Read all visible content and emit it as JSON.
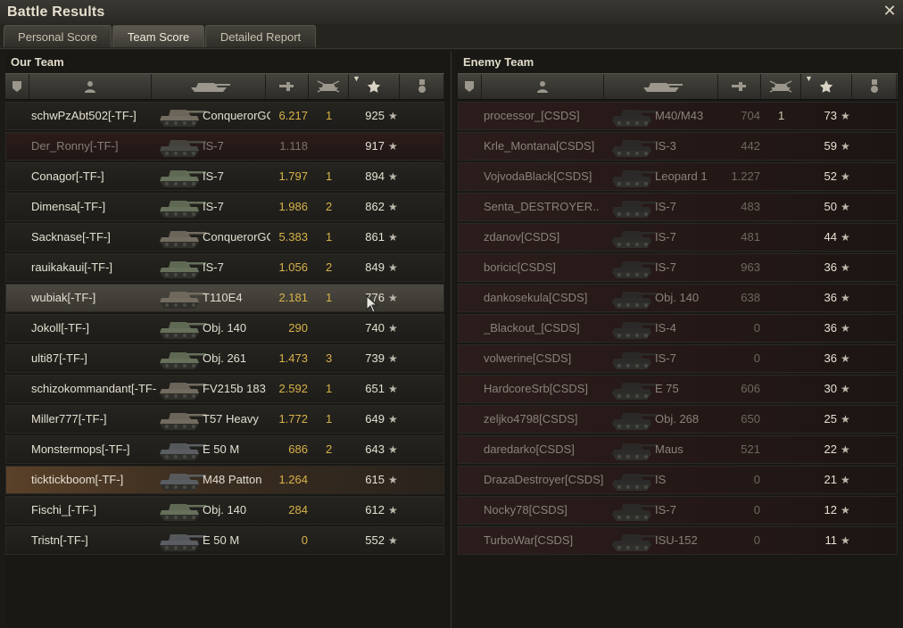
{
  "window": {
    "title": "Battle Results",
    "close_icon": "close-icon"
  },
  "tabs": [
    {
      "label": "Personal Score",
      "active": false
    },
    {
      "label": "Team Score",
      "active": true
    },
    {
      "label": "Detailed Report",
      "active": false
    }
  ],
  "our_team": {
    "title": "Our Team",
    "rows": [
      {
        "player": "schwPzAbt502[-TF-]",
        "tank": "ConquerorGC",
        "damage": "6.217",
        "kills": "1",
        "xp": "925",
        "state": "alive"
      },
      {
        "player": "Der_Ronny[-TF-]",
        "tank": "IS-7",
        "damage": "1.118",
        "kills": "",
        "xp": "917",
        "state": "dead"
      },
      {
        "player": "Conagor[-TF-]",
        "tank": "IS-7",
        "damage": "1.797",
        "kills": "1",
        "xp": "894",
        "state": "alive"
      },
      {
        "player": "Dimensa[-TF-]",
        "tank": "IS-7",
        "damage": "1.986",
        "kills": "2",
        "xp": "862",
        "state": "alive"
      },
      {
        "player": "Sacknase[-TF-]",
        "tank": "ConquerorGC",
        "damage": "5.383",
        "kills": "1",
        "xp": "861",
        "state": "alive"
      },
      {
        "player": "rauikakaui[-TF-]",
        "tank": "IS-7",
        "damage": "1.056",
        "kills": "2",
        "xp": "849",
        "state": "alive"
      },
      {
        "player": "wubiak[-TF-]",
        "tank": "T110E4",
        "damage": "2.181",
        "kills": "1",
        "xp": "776",
        "state": "hover"
      },
      {
        "player": "Jokoll[-TF-]",
        "tank": "Obj. 140",
        "damage": "290",
        "kills": "",
        "xp": "740",
        "state": "alive"
      },
      {
        "player": "ulti87[-TF-]",
        "tank": "Obj. 261",
        "damage": "1.473",
        "kills": "3",
        "xp": "739",
        "state": "alive"
      },
      {
        "player": "schizokommandant[-TF-]",
        "tank": "FV215b 183",
        "damage": "2.592",
        "kills": "1",
        "xp": "651",
        "state": "alive"
      },
      {
        "player": "Miller777[-TF-]",
        "tank": "T57 Heavy",
        "damage": "1.772",
        "kills": "1",
        "xp": "649",
        "state": "alive"
      },
      {
        "player": "Monstermops[-TF-]",
        "tank": "E 50 M",
        "damage": "686",
        "kills": "2",
        "xp": "643",
        "state": "alive"
      },
      {
        "player": "ticktickboom[-TF-]",
        "tank": "M48 Patton",
        "damage": "1.264",
        "kills": "",
        "xp": "615",
        "state": "self"
      },
      {
        "player": "Fischi_[-TF-]",
        "tank": "Obj. 140",
        "damage": "284",
        "kills": "",
        "xp": "612",
        "state": "alive"
      },
      {
        "player": "Tristn[-TF-]",
        "tank": "E 50 M",
        "damage": "0",
        "kills": "",
        "xp": "552",
        "state": "alive"
      }
    ]
  },
  "enemy_team": {
    "title": "Enemy Team",
    "rows": [
      {
        "player": "processor_[CSDS]",
        "tank": "M40/M43",
        "damage": "704",
        "kills": "1",
        "xp": "73",
        "state": "dead"
      },
      {
        "player": "Krle_Montana[CSDS]",
        "tank": "IS-3",
        "damage": "442",
        "kills": "",
        "xp": "59",
        "state": "dead"
      },
      {
        "player": "VojvodaBlack[CSDS]",
        "tank": "Leopard 1",
        "damage": "1.227",
        "kills": "",
        "xp": "52",
        "state": "dead"
      },
      {
        "player": "Senta_DESTROYER..",
        "tank": "IS-7",
        "damage": "483",
        "kills": "",
        "xp": "50",
        "state": "dead"
      },
      {
        "player": "zdanov[CSDS]",
        "tank": "IS-7",
        "damage": "481",
        "kills": "",
        "xp": "44",
        "state": "dead"
      },
      {
        "player": "boricic[CSDS]",
        "tank": "IS-7",
        "damage": "963",
        "kills": "",
        "xp": "36",
        "state": "dead"
      },
      {
        "player": "dankosekula[CSDS]",
        "tank": "Obj. 140",
        "damage": "638",
        "kills": "",
        "xp": "36",
        "state": "dead"
      },
      {
        "player": "_Blackout_[CSDS]",
        "tank": "IS-4",
        "damage": "0",
        "kills": "",
        "xp": "36",
        "state": "dead"
      },
      {
        "player": "volwerine[CSDS]",
        "tank": "IS-7",
        "damage": "0",
        "kills": "",
        "xp": "36",
        "state": "dead"
      },
      {
        "player": "HardcoreSrb[CSDS]",
        "tank": "E 75",
        "damage": "606",
        "kills": "",
        "xp": "30",
        "state": "dead"
      },
      {
        "player": "zeljko4798[CSDS]",
        "tank": "Obj. 268",
        "damage": "650",
        "kills": "",
        "xp": "25",
        "state": "dead"
      },
      {
        "player": "daredarko[CSDS]",
        "tank": "Maus",
        "damage": "521",
        "kills": "",
        "xp": "22",
        "state": "dead"
      },
      {
        "player": "DrazaDestroyer[CSDS]",
        "tank": "IS",
        "damage": "0",
        "kills": "",
        "xp": "21",
        "state": "dead"
      },
      {
        "player": "Nocky78[CSDS]",
        "tank": "IS-7",
        "damage": "0",
        "kills": "",
        "xp": "12",
        "state": "dead"
      },
      {
        "player": "TurboWar[CSDS]",
        "tank": "ISU-152",
        "damage": "0",
        "kills": "",
        "xp": "11",
        "state": "dead"
      }
    ]
  },
  "columns": [
    "squad-icon",
    "player-icon",
    "tank-icon",
    "damage-icon",
    "kills-icon",
    "xp-star-icon",
    "medal-icon"
  ],
  "colors": {
    "damage": "#d8b24a",
    "accent": "#e4dfd1",
    "dead_row": "#2c1c1a",
    "self_row": "#5a4129"
  }
}
